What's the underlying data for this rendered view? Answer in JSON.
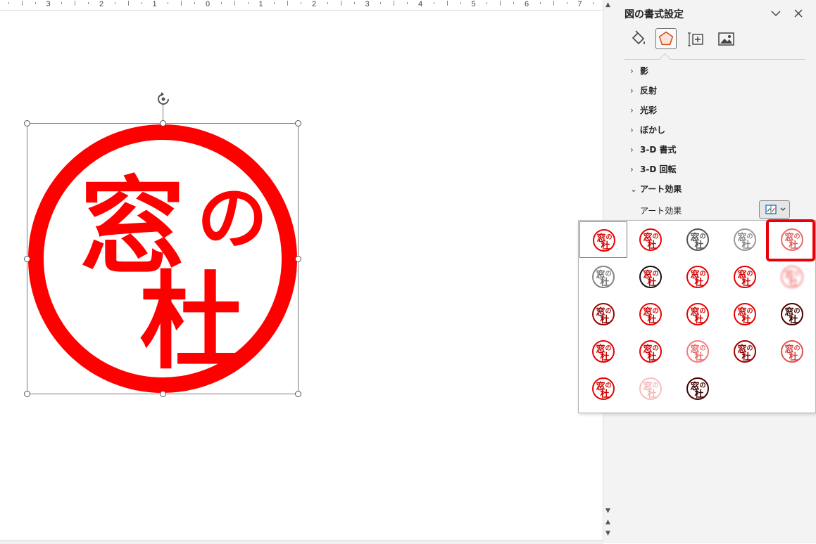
{
  "ruler": {
    "labels": [
      "3",
      "2",
      "1",
      "0",
      "1",
      "2",
      "3",
      "4",
      "5",
      "6",
      "7"
    ]
  },
  "document": {
    "stamp": {
      "chars": [
        "窓",
        "の",
        "杜"
      ],
      "color": "#ff0000"
    }
  },
  "pane": {
    "title": "図の書式設定",
    "tabs": [
      {
        "icon": "fill-line-icon",
        "active": false
      },
      {
        "icon": "effects-icon",
        "active": true
      },
      {
        "icon": "size-properties-icon",
        "active": false
      },
      {
        "icon": "picture-icon",
        "active": false
      }
    ],
    "sections": [
      {
        "label": "影",
        "expanded": false
      },
      {
        "label": "反射",
        "expanded": false
      },
      {
        "label": "光彩",
        "expanded": false
      },
      {
        "label": "ぼかし",
        "expanded": false
      },
      {
        "label": "3-D 書式",
        "expanded": false
      },
      {
        "label": "3-D 回転",
        "expanded": false
      },
      {
        "label": "アート効果",
        "expanded": true
      }
    ],
    "art_effect_label": "アート効果",
    "accent": "#e8000a"
  },
  "gallery": {
    "rows": [
      [
        "red",
        "red",
        "gray",
        "lightgray",
        "red-faint"
      ],
      [
        "gray-sketch",
        "red-black",
        "red",
        "red",
        "blur"
      ],
      [
        "red-dark",
        "red",
        "red",
        "red",
        "dark"
      ],
      [
        "red",
        "red",
        "red-soft",
        "red-dark",
        "red-outline"
      ],
      [
        "red",
        "pink-light",
        "dark"
      ]
    ],
    "selected_index": 0,
    "highlighted_index": 4
  }
}
